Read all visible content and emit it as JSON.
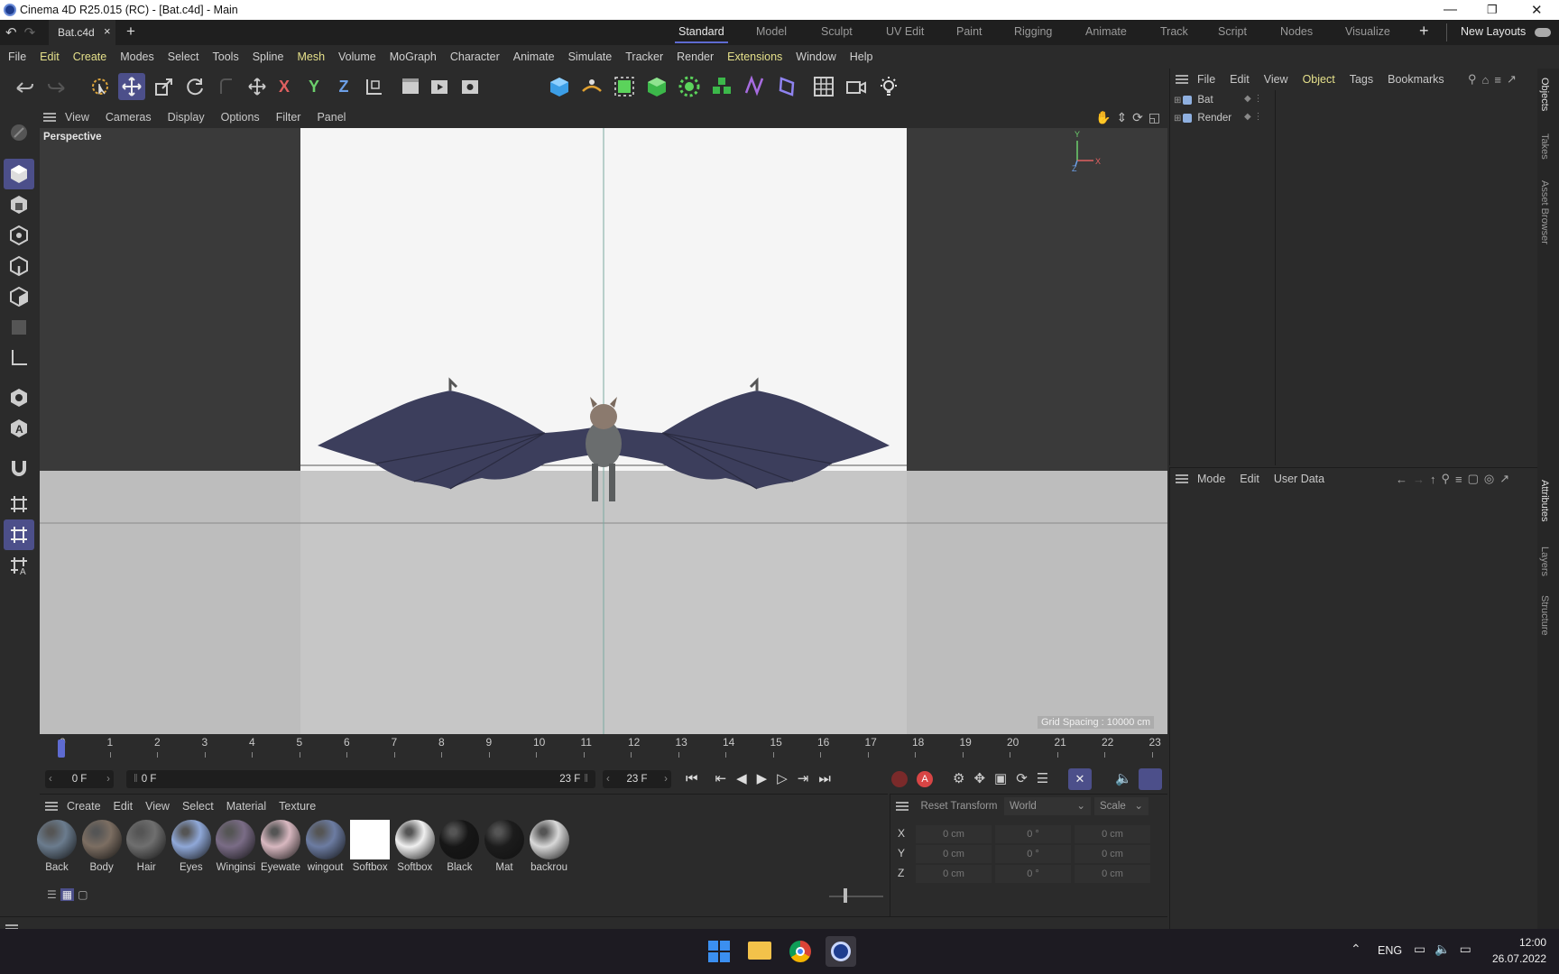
{
  "window": {
    "title": "Cinema 4D R25.015 (RC) - [Bat.c4d] - Main"
  },
  "doc_tab": {
    "name": "Bat.c4d",
    "close": "×",
    "add": "+"
  },
  "layouts": {
    "items": [
      "Standard",
      "Model",
      "Sculpt",
      "UV Edit",
      "Paint",
      "Rigging",
      "Animate",
      "Track",
      "Script",
      "Nodes",
      "Visualize"
    ],
    "active": "Standard",
    "add": "+",
    "new_layouts": "New Layouts"
  },
  "menu": {
    "items": [
      "File",
      "Edit",
      "Create",
      "Modes",
      "Select",
      "Tools",
      "Spline",
      "Mesh",
      "Volume",
      "MoGraph",
      "Character",
      "Animate",
      "Simulate",
      "Tracker",
      "Render",
      "Extensions",
      "Window",
      "Help"
    ],
    "highlighted": [
      "Edit",
      "Create",
      "Mesh",
      "Extensions"
    ]
  },
  "toolbar": {
    "axis_x": "X",
    "axis_y": "Y",
    "axis_z": "Z"
  },
  "viewport": {
    "menu": [
      "View",
      "Cameras",
      "Display",
      "Options",
      "Filter",
      "Panel"
    ],
    "camera_label": "Perspective",
    "grid_spacing": "Grid Spacing : 10000 cm",
    "axis_labels": {
      "x": "X",
      "y": "Y",
      "z": "Z"
    }
  },
  "object_manager": {
    "menu": [
      "File",
      "Edit",
      "View",
      "Object",
      "Tags",
      "Bookmarks"
    ],
    "active_menu": "Object",
    "objects": [
      "Bat",
      "Render"
    ]
  },
  "attribute_manager": {
    "menu": [
      "Mode",
      "Edit",
      "User Data"
    ]
  },
  "right_tabs": [
    "Objects",
    "Takes",
    "Asset Browser",
    "Attributes",
    "Layers",
    "Structure"
  ],
  "timeline": {
    "frames": [
      "0",
      "1",
      "2",
      "3",
      "4",
      "5",
      "6",
      "7",
      "8",
      "9",
      "10",
      "11",
      "12",
      "13",
      "14",
      "15",
      "16",
      "17",
      "18",
      "19",
      "20",
      "21",
      "22",
      "23"
    ],
    "current_frame": "0 F",
    "range_start": "0 F",
    "range_end": "23 F",
    "end_frame": "23 F"
  },
  "material_manager": {
    "menu": [
      "Create",
      "Edit",
      "View",
      "Select",
      "Material",
      "Texture"
    ],
    "materials": [
      {
        "name": "Back",
        "color": "#6b7c8e"
      },
      {
        "name": "Body",
        "color": "#7c6e62"
      },
      {
        "name": "Hair",
        "color": "#6f6f6f"
      },
      {
        "name": "Eyes",
        "color": "#8fa8d8"
      },
      {
        "name": "Winginsi",
        "color": "#7a6c86"
      },
      {
        "name": "Eyewate",
        "color": "#d8b8c0"
      },
      {
        "name": "wingout",
        "color": "#6c7ca2"
      },
      {
        "name": "Softbox",
        "color": "#ffffff"
      },
      {
        "name": "Softbox",
        "color": "#f0f0f0"
      },
      {
        "name": "Black",
        "color": "#161616"
      },
      {
        "name": "Mat",
        "color": "#1c1c1c"
      },
      {
        "name": "backrou",
        "color": "#d8d8d8"
      }
    ]
  },
  "coordinates": {
    "reset": "Reset Transform",
    "space": "World",
    "mode": "Scale",
    "rows": [
      {
        "axis": "X",
        "pos": "0 cm",
        "rot": "0 °",
        "size": "0 cm"
      },
      {
        "axis": "Y",
        "pos": "0 cm",
        "rot": "0 °",
        "size": "0 cm"
      },
      {
        "axis": "Z",
        "pos": "0 cm",
        "rot": "0 °",
        "size": "0 cm"
      }
    ]
  },
  "taskbar": {
    "lang": "ENG",
    "time": "12:00",
    "date": "26.07.2022"
  }
}
